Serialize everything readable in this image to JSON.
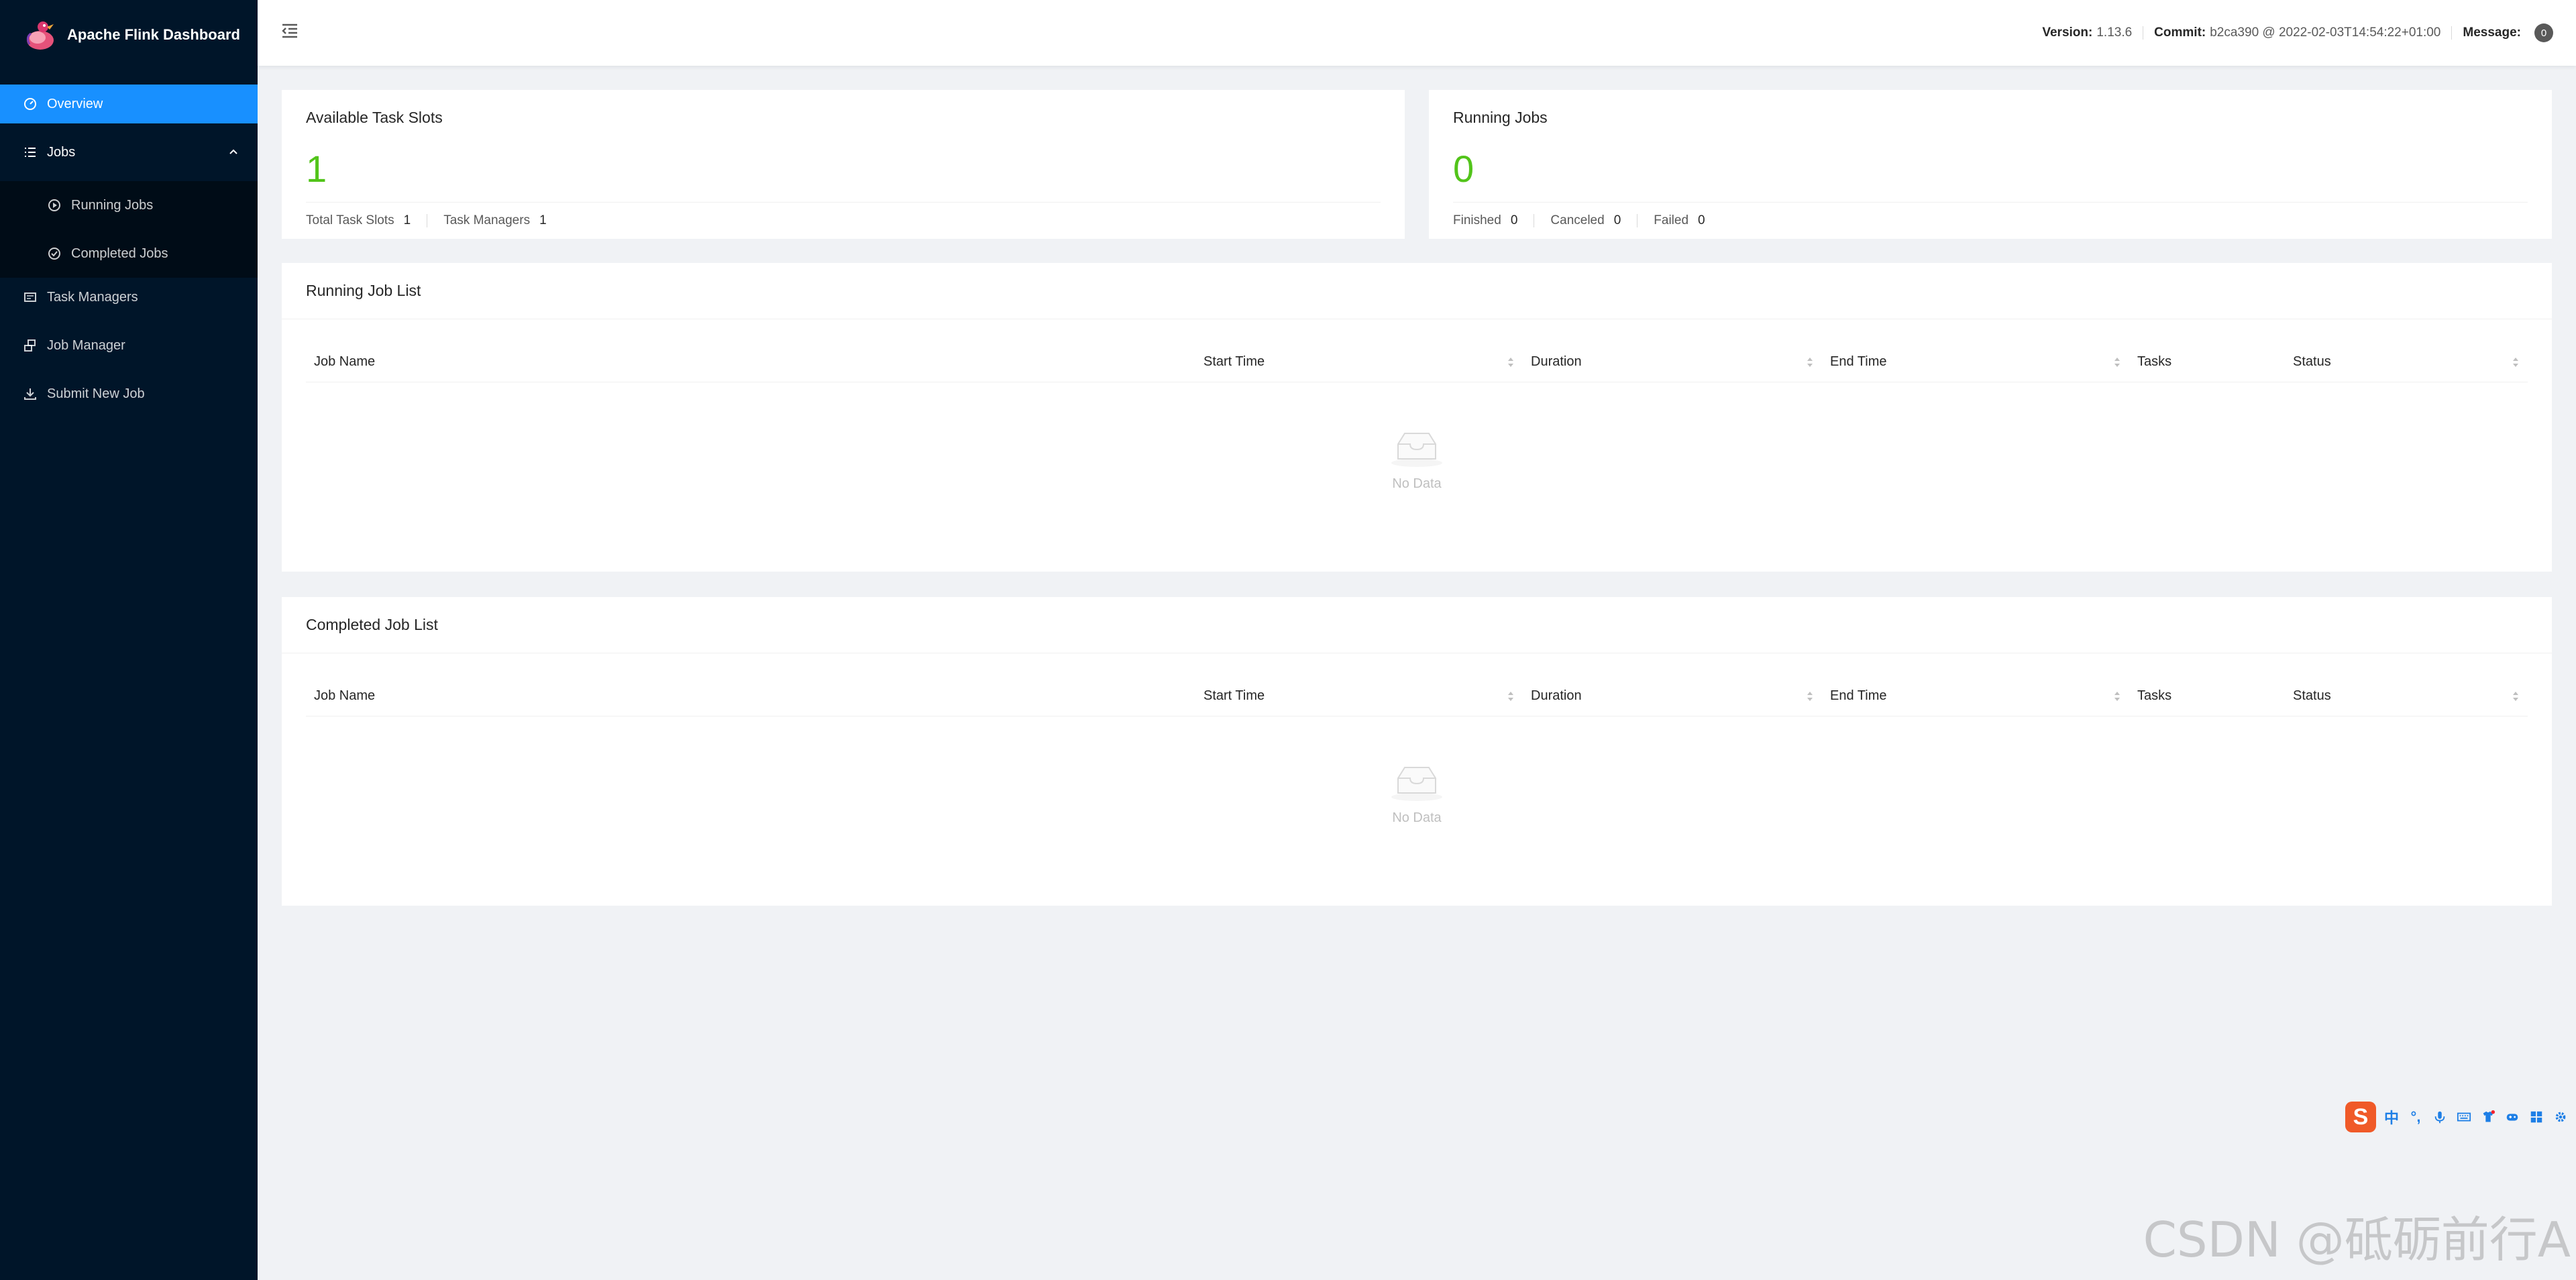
{
  "app": {
    "title": "Apache Flink Dashboard"
  },
  "sidebar": {
    "overview": "Overview",
    "jobs": "Jobs",
    "running_jobs": "Running Jobs",
    "completed_jobs": "Completed Jobs",
    "task_managers": "Task Managers",
    "job_manager": "Job Manager",
    "submit_new_job": "Submit New Job"
  },
  "header": {
    "version_label": "Version:",
    "version": "1.13.6",
    "commit_label": "Commit:",
    "commit": "b2ca390 @ 2022-02-03T14:54:22+01:00",
    "message_label": "Message:",
    "message_count": "0"
  },
  "slots_card": {
    "title": "Available Task Slots",
    "value": "1",
    "total_label": "Total Task Slots",
    "total_value": "1",
    "tm_label": "Task Managers",
    "tm_value": "1"
  },
  "running_card": {
    "title": "Running Jobs",
    "value": "0",
    "finished_label": "Finished",
    "finished_value": "0",
    "canceled_label": "Canceled",
    "canceled_value": "0",
    "failed_label": "Failed",
    "failed_value": "0"
  },
  "running_list": {
    "title": "Running Job List",
    "columns": [
      "Job Name",
      "Start Time",
      "Duration",
      "End Time",
      "Tasks",
      "Status"
    ],
    "empty": "No Data"
  },
  "completed_list": {
    "title": "Completed Job List",
    "columns": [
      "Job Name",
      "Start Time",
      "Duration",
      "End Time",
      "Tasks",
      "Status"
    ],
    "empty": "No Data"
  },
  "ime": {
    "logo": "S",
    "mode": "中"
  },
  "watermark": "CSDN @砥砺前行A",
  "colors": {
    "sidebar": "#001529",
    "selected": "#1890ff",
    "stat": "#52c41a"
  }
}
